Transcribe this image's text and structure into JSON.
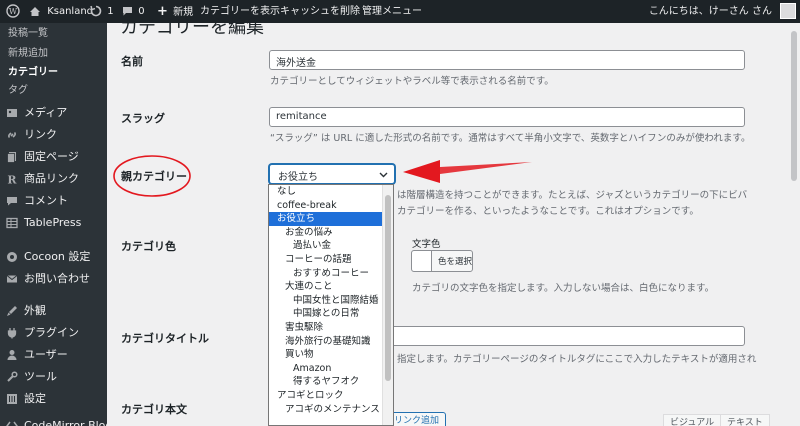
{
  "admin_bar": {
    "site_name": "Ksanland",
    "updates_count": "1",
    "comments_count": "0",
    "new_label": "新規",
    "view_category": "カテゴリーを表示",
    "clear_cache": "キャッシュを削除",
    "admin_menu": "管理メニュー",
    "greeting": "こんにちは、けーさん さん"
  },
  "sidebar": {
    "submenu": [
      "投稿一覧",
      "新規追加",
      "カテゴリー",
      "タグ"
    ],
    "items": [
      {
        "label": "メディア",
        "icon": "media-icon"
      },
      {
        "label": "リンク",
        "icon": "link-icon"
      },
      {
        "label": "固定ページ",
        "icon": "pages-icon"
      },
      {
        "label": "商品リンク",
        "icon": "rinker-icon"
      },
      {
        "label": "コメント",
        "icon": "comments-icon"
      },
      {
        "label": "TablePress",
        "icon": "table-icon"
      },
      {
        "label": "Cocoon 設定",
        "icon": "cocoon-icon"
      },
      {
        "label": "お問い合わせ",
        "icon": "mail-icon"
      },
      {
        "label": "外観",
        "icon": "appearance-icon"
      },
      {
        "label": "プラグイン",
        "icon": "plugins-icon"
      },
      {
        "label": "ユーザー",
        "icon": "users-icon"
      },
      {
        "label": "ツール",
        "icon": "tools-icon"
      },
      {
        "label": "設定",
        "icon": "settings-icon"
      },
      {
        "label": "CodeMirror Blocks",
        "icon": "codemirror-icon"
      }
    ]
  },
  "main": {
    "page_title": "カテゴリーを編集",
    "name_label": "名前",
    "name_value": "海外送金",
    "name_desc": "カテゴリーとしてウィジェットやラベル等で表示される名前です。",
    "slug_label": "スラッグ",
    "slug_value": "remitance",
    "slug_desc": "“スラッグ” は URL に適した形式の名前です。通常はすべて半角小文字で、英数字とハイフンのみが使われます。",
    "parent_label": "親カテゴリー",
    "parent_value": "お役立ち",
    "parent_desc_1": "は階層構造を持つことができます。たとえば、ジャズというカテゴリーの下にビバ",
    "parent_desc_2": "カテゴリーを作る、といったようなことです。これはオプションです。",
    "cat_color_label": "カテゴリ色",
    "text_color_label": "文字色",
    "select_color_button": "色を選択",
    "text_color_desc": "カテゴリの文字色を指定します。入力しない場合は、白色になります。",
    "cat_title_label": "カテゴリタイトル",
    "cat_title_desc": "指定します。カテゴリーページのタイトルタグにここで入力したテキストが適用され",
    "cat_body_label": "カテゴリ本文",
    "add_link_button": "リンク追加",
    "visual_tab": "ビジュアル",
    "text_tab": "テキスト"
  },
  "dropdown": {
    "selected_index": 2,
    "options": [
      {
        "label": "なし",
        "level": 0
      },
      {
        "label": "coffee-break",
        "level": 0
      },
      {
        "label": "お役立ち",
        "level": 0
      },
      {
        "label": "お金の悩み",
        "level": 1
      },
      {
        "label": "過払い金",
        "level": 2
      },
      {
        "label": "コーヒーの話題",
        "level": 1
      },
      {
        "label": "おすすめコーヒー",
        "level": 2
      },
      {
        "label": "大連のこと",
        "level": 1
      },
      {
        "label": "中国女性と国際結婚",
        "level": 2
      },
      {
        "label": "中国嫁との日常",
        "level": 2
      },
      {
        "label": "害虫駆除",
        "level": 1
      },
      {
        "label": "海外旅行の基礎知識",
        "level": 1
      },
      {
        "label": "買い物",
        "level": 1
      },
      {
        "label": "Amazon",
        "level": 2
      },
      {
        "label": "得するヤフオク",
        "level": 2
      },
      {
        "label": "アコギとロック",
        "level": 0
      },
      {
        "label": "アコギのメンテナンス",
        "level": 1
      }
    ]
  },
  "colors": {
    "admin_bar_bg": "#1d2327",
    "sidebar_bg": "#2c3338",
    "accent": "#2271b1",
    "selected_option": "#1e6fd9",
    "annotation_red": "#e3181f"
  }
}
